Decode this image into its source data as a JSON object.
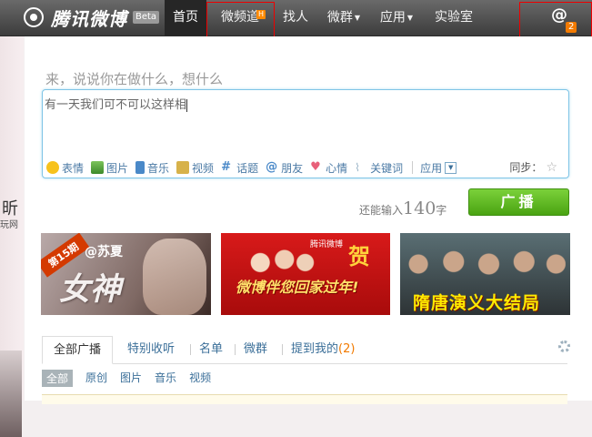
{
  "brand": {
    "name": "腾讯微博",
    "beta": "Beta"
  },
  "nav": {
    "items": [
      {
        "label": "首页",
        "active": true
      },
      {
        "label": "微频道",
        "hot": "H"
      },
      {
        "label": "找人"
      },
      {
        "label": "微群",
        "dropdown": true
      },
      {
        "label": "应用",
        "dropdown": true
      },
      {
        "label": "实验室"
      }
    ],
    "mentions_icon": "@",
    "mentions_count": "2"
  },
  "left_strip": {
    "glyph": "昕",
    "small": "玩网"
  },
  "composer": {
    "prompt": "来，说说你在做什么，想什么",
    "text": "有一天我们可不可以这样相",
    "tools": [
      {
        "label": "表情",
        "icon": "smile-icon"
      },
      {
        "label": "图片",
        "icon": "image-icon"
      },
      {
        "label": "音乐",
        "icon": "music-icon"
      },
      {
        "label": "视频",
        "icon": "video-icon"
      },
      {
        "label": "话题",
        "icon": "hash-icon"
      },
      {
        "label": "朋友",
        "icon": "at-icon"
      },
      {
        "label": "心情",
        "icon": "heart-icon"
      },
      {
        "label": "关键词",
        "icon": "rss-icon"
      }
    ],
    "apps_label": "应用",
    "sync_label": "同步：",
    "remaining_prefix": "还能输入",
    "remaining_count": "140",
    "remaining_suffix": "字",
    "submit_label": "广播"
  },
  "banners": [
    {
      "tag": "第15期",
      "name": "@苏夏",
      "title": "女神"
    },
    {
      "logo": "腾讯微博",
      "title": "微博伴您回家过年!",
      "gold": "贺"
    },
    {
      "title": "隋唐演义大结局"
    }
  ],
  "feed": {
    "tabs": [
      {
        "label": "全部广播",
        "active": true
      },
      {
        "label": "特别收听"
      },
      {
        "label": "名单"
      },
      {
        "label": "微群"
      },
      {
        "label": "提到我的",
        "count": "(2)"
      }
    ],
    "subtabs": [
      {
        "label": "全部",
        "active": true
      },
      {
        "label": "原创"
      },
      {
        "label": "图片"
      },
      {
        "label": "音乐"
      },
      {
        "label": "视频"
      }
    ]
  },
  "colors": {
    "nav_bg": "#4a4a4a",
    "accent_blue": "#3b6f99",
    "broadcast_green": "#5cb91f",
    "count_orange": "#f27a00"
  }
}
